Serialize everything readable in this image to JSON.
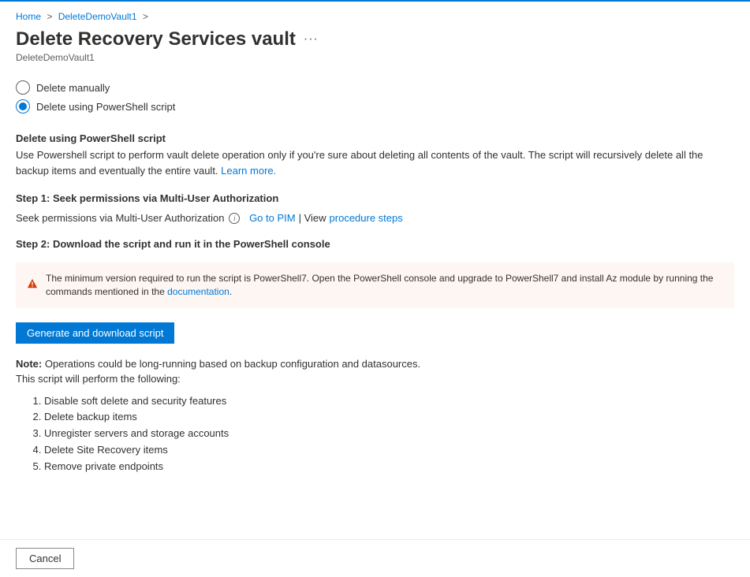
{
  "breadcrumb": {
    "home": "Home",
    "vault": "DeleteDemoVault1"
  },
  "header": {
    "title": "Delete Recovery Services vault",
    "subtitle": "DeleteDemoVault1"
  },
  "radio": {
    "manual": "Delete manually",
    "powershell": "Delete using PowerShell script"
  },
  "section": {
    "heading": "Delete using PowerShell script",
    "description_pre": "Use Powershell script to perform vault delete operation only if you're sure about deleting all contents of the vault. The script will recursively delete all the backup items and eventually the entire vault. ",
    "learn_more": "Learn more."
  },
  "step1": {
    "heading": "Step 1: Seek permissions via Multi-User Authorization",
    "text": "Seek permissions via Multi-User Authorization",
    "go_to_pim": "Go to PIM",
    "view_sep": " | View ",
    "procedure_steps": "procedure steps"
  },
  "step2": {
    "heading": "Step 2: Download the script and run it in the PowerShell console"
  },
  "warning": {
    "text_pre": "The minimum version required to run the script is PowerShell7. Open the PowerShell console and upgrade to PowerShell7 and install Az module by running the commands mentioned in the ",
    "doc_link": "documentation",
    "text_post": "."
  },
  "button": {
    "generate": "Generate and download script",
    "cancel": "Cancel"
  },
  "note": {
    "label": "Note:",
    "text": " Operations could be long-running based on backup configuration and datasources.",
    "subtext": "This script will perform the following:"
  },
  "list": {
    "item1": "Disable soft delete and security features",
    "item2": "Delete backup items",
    "item3": "Unregister servers and storage accounts",
    "item4": "Delete Site Recovery items",
    "item5": "Remove private endpoints"
  }
}
